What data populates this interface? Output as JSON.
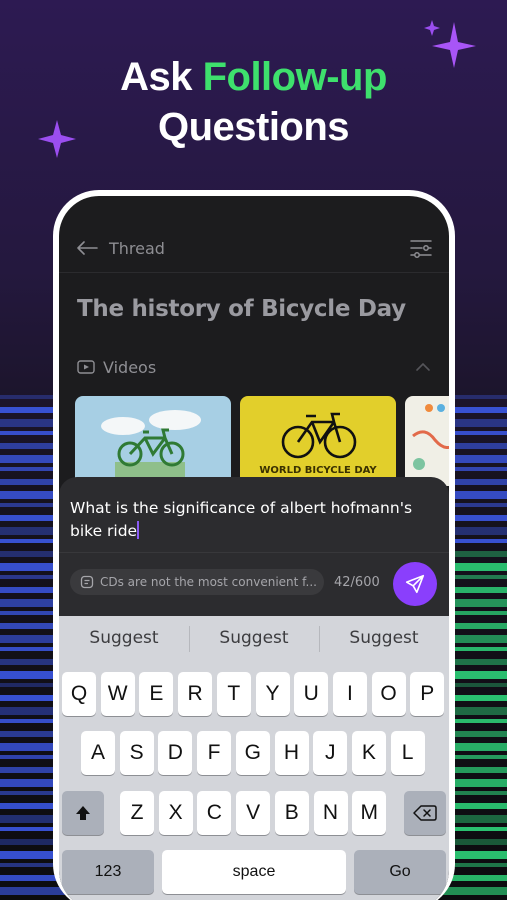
{
  "headline": {
    "line1_plain": "Ask ",
    "line1_accent": "Follow-up",
    "line2": "Questions"
  },
  "colors": {
    "accent_green": "#3ee06d",
    "send_purple": "#8a3ffc",
    "stripe_blue": "#3c58e6",
    "stripe_green": "#2ed47a"
  },
  "topbar": {
    "back_label": "Thread",
    "back_icon": "arrow-left-icon",
    "filter_icon": "sliders-icon"
  },
  "page_title": "The history of Bicycle Day",
  "section": {
    "label": "Videos",
    "icon": "play-rectangle-icon",
    "toggle_icon": "chevron-up-icon"
  },
  "videos": [
    {
      "label": ""
    },
    {
      "label": "WORLD BICYCLE DAY"
    },
    {
      "label": ""
    }
  ],
  "composer": {
    "value": "What is the significance of albert hofmann's bike ride",
    "context_chip": "CDs are not the most convenient f...",
    "char_count": "42/600",
    "send_icon": "paper-plane-icon"
  },
  "keyboard": {
    "suggestions": [
      "Suggest",
      "Suggest",
      "Suggest"
    ],
    "row1": [
      "Q",
      "W",
      "E",
      "R",
      "T",
      "Y",
      "U",
      "I",
      "O",
      "P"
    ],
    "row2": [
      "A",
      "S",
      "D",
      "F",
      "G",
      "H",
      "J",
      "K",
      "L"
    ],
    "row3": [
      "Z",
      "X",
      "C",
      "V",
      "B",
      "N",
      "M"
    ],
    "numbers_label": "123",
    "space_label": "space",
    "go_label": "Go"
  }
}
